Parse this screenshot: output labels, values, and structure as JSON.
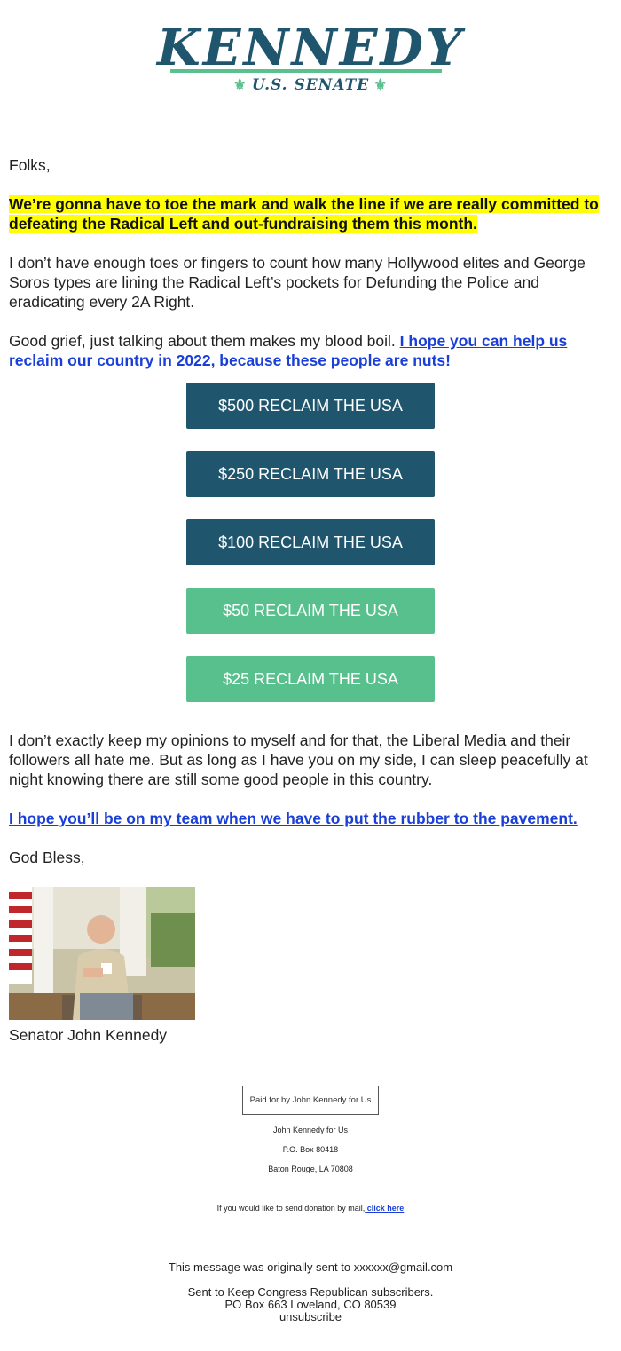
{
  "logo": {
    "title": "KENNEDY",
    "subtitle": "U.S. SENATE",
    "ornament": "⚜"
  },
  "letter": {
    "greeting": "Folks,",
    "highlight": "We’re gonna have to toe the mark and walk the line if we are really committed to defeating the Radical Left and out-fundraising them this month.",
    "para1": "I don’t have enough toes or fingers to count how many Hollywood elites and George Soros types are lining the Radical Left’s pockets for Defunding the Police and eradicating every 2A Right.",
    "para2_text": "Good grief, just talking about them makes my blood boil. ",
    "para2_link": "I hope you can help us reclaim our country in 2022, because these people are nuts!",
    "para3": "I don’t exactly keep my opinions to myself and for that, the Liberal Media and their followers all hate me. But as long as I have you on my side, I can sleep peacefully at night knowing there are still some good people in this country.",
    "team_link": "I hope you’ll be on my team when we have to put the rubber to the pavement.",
    "closing": "God Bless,",
    "signature": "Senator John Kennedy"
  },
  "buttons": [
    {
      "label": "$500 RECLAIM THE USA",
      "color": "#1f566e"
    },
    {
      "label": "$250 RECLAIM THE USA",
      "color": "#1f566e"
    },
    {
      "label": "$100 RECLAIM THE USA",
      "color": "#1f566e"
    },
    {
      "label": "$50 RECLAIM THE USA",
      "color": "#58c08c"
    },
    {
      "label": "$25 RECLAIM THE USA",
      "color": "#58c08c"
    }
  ],
  "footer": {
    "paid_for": "Paid for by John Kennedy for Us",
    "org": "John Kennedy for Us",
    "po_box": "P.O. Box 80418",
    "city": "Baton Rouge, LA 70808",
    "mail_text": "If you would like to send donation by mail,",
    "mail_link": " click here",
    "sent_to": "This message was originally sent to xxxxxx@gmail.com",
    "subscribers": "Sent to Keep Congress Republican subscribers.",
    "address2": "PO Box 663 Loveland, CO 80539",
    "unsubscribe": "unsubscribe"
  },
  "colors": {
    "brand_dark": "#1f566e",
    "brand_green": "#58c08c",
    "highlight": "#ffff00",
    "link": "#1a3fd6"
  }
}
